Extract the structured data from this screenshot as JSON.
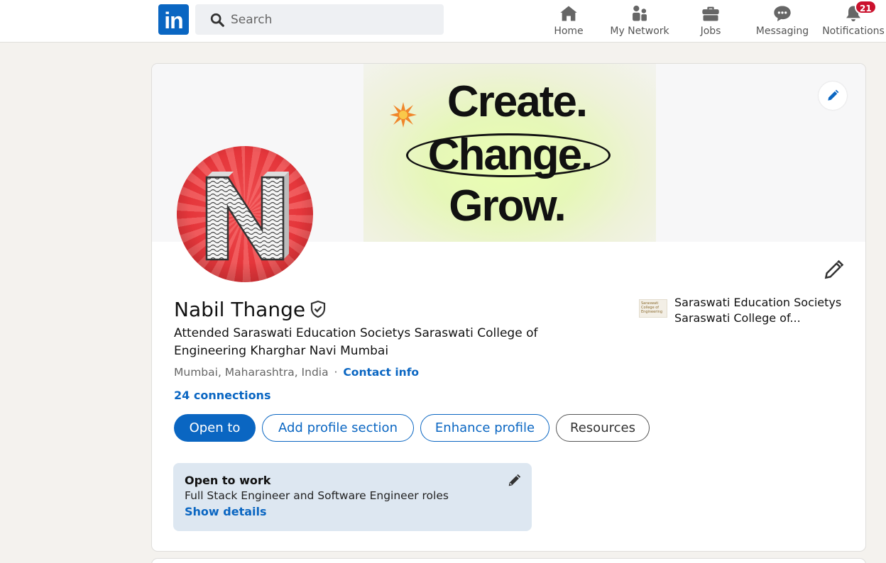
{
  "nav": {
    "logo_text": "in",
    "search_placeholder": "Search",
    "items": [
      {
        "label": "Home",
        "icon": "home-icon"
      },
      {
        "label": "My Network",
        "icon": "network-icon"
      },
      {
        "label": "Jobs",
        "icon": "briefcase-icon"
      },
      {
        "label": "Messaging",
        "icon": "message-icon"
      },
      {
        "label": "Notifications",
        "icon": "bell-icon",
        "badge": "21"
      }
    ]
  },
  "banner": {
    "line1": "Create.",
    "line2": "Change.",
    "line3": "Grow."
  },
  "profile": {
    "name": "Nabil Thange",
    "headline": "Attended Saraswati Education Societys Saraswati College of Engineering Kharghar Navi Mumbai",
    "location": "Mumbai, Maharashtra, India",
    "separator": "·",
    "contact_info": "Contact info",
    "connections": "24 connections",
    "school_name": "Saraswati Education Societys Saraswati College of...",
    "school_logo_text": "Saraswati College of Engineering"
  },
  "actions": {
    "open_to": "Open to",
    "add_section": "Add profile section",
    "enhance": "Enhance profile",
    "resources": "Resources"
  },
  "open_to_work": {
    "title": "Open to work",
    "roles": "Full Stack Engineer and Software Engineer roles",
    "show_details": "Show details"
  },
  "colors": {
    "brand": "#0a66c2",
    "badge": "#cb112d",
    "avatar_red": "#e5363b"
  }
}
